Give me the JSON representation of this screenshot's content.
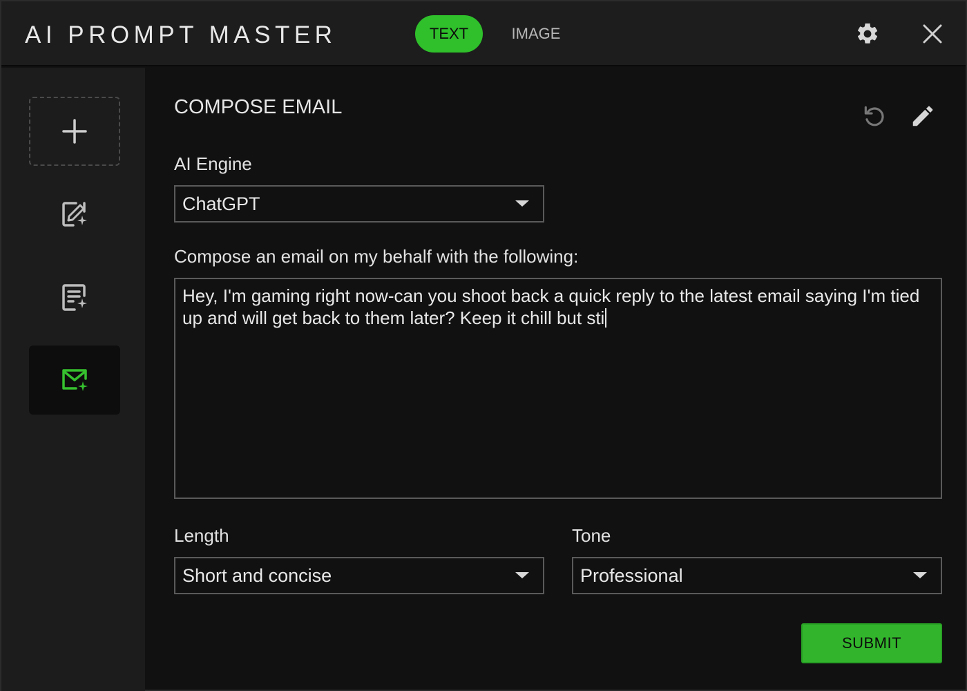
{
  "app": {
    "title": "AI PROMPT MASTER"
  },
  "tabs": [
    {
      "label": "TEXT",
      "active": true
    },
    {
      "label": "IMAGE",
      "active": false
    }
  ],
  "titlebar_icons": [
    "gear-icon",
    "close-icon"
  ],
  "sidebar": {
    "items": [
      {
        "icon": "plus-icon",
        "active": false
      },
      {
        "icon": "edit-sparkle-icon",
        "active": false
      },
      {
        "icon": "document-sparkle-icon",
        "active": false
      },
      {
        "icon": "mail-sparkle-icon",
        "active": true
      }
    ]
  },
  "main": {
    "title": "COMPOSE EMAIL",
    "header_icons": [
      "reset-icon",
      "pencil-icon"
    ],
    "engine": {
      "label": "AI Engine",
      "value": "ChatGPT"
    },
    "prompt": {
      "label": "Compose an email on my behalf with the following:",
      "value": "Hey, I'm gaming right now-can you shoot back a quick reply to the latest email saying I'm tied up and will get back to them later? Keep it chill but sti"
    },
    "length": {
      "label": "Length",
      "value": "Short and concise"
    },
    "tone": {
      "label": "Tone",
      "value": "Professional"
    },
    "submit_label": "SUBMIT"
  },
  "colors": {
    "accent": "#2fc02b",
    "background": "#111111",
    "sidebar": "#1c1c1c",
    "titlebar": "#1d1d1d"
  }
}
